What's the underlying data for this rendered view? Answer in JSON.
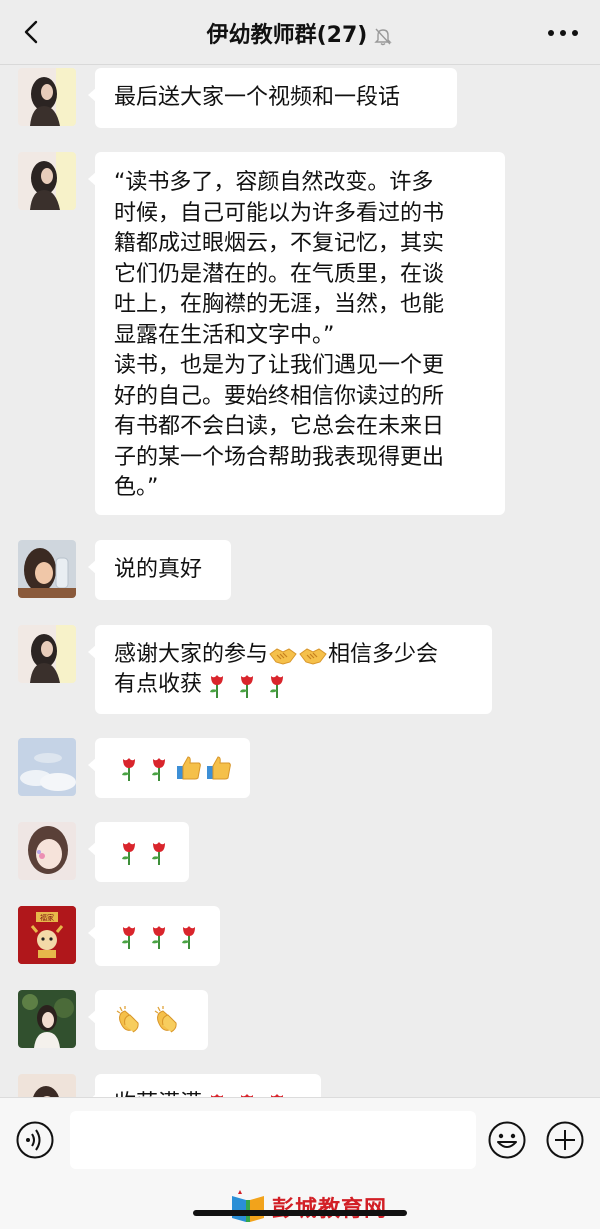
{
  "header": {
    "title": "伊幼教师群(27)",
    "back_icon": "chevron-left-icon",
    "mute_icon": "bell-muted-icon",
    "more_icon": "more-dots-icon"
  },
  "messages": [
    {
      "avatar": "avatar-girl-long-hair",
      "text": "最后送大家一个视频和一段话"
    },
    {
      "avatar": "avatar-girl-long-hair",
      "text": "“读书多了，容颜自然改变。许多\n时候，自己可能以为许多看过的书\n籍都成过眼烟云，不复记忆，其实\n它们仍是潜在的。在气质里，在谈\n吐上，在胸襟的无涯，当然，也能\n显露在生活和文字中。”\n读书，也是为了让我们遇见一个更\n好的自己。要始终相信你读过的所\n有书都不会白读，它总会在未来日\n子的某一个场合帮助我表现得更出\n色。”"
    },
    {
      "avatar": "avatar-child-drinking",
      "text": "说的真好"
    },
    {
      "avatar": "avatar-girl-long-hair",
      "text_line1": "感谢大家的参与",
      "text_line1_after": "相信多少会",
      "text_line2": "有点收获",
      "emoji_line1": [
        "handshake",
        "handshake"
      ],
      "emoji_line2": [
        "rose",
        "rose",
        "rose"
      ]
    },
    {
      "avatar": "avatar-sky-clouds",
      "emojis": [
        "rose",
        "rose",
        "thumbs-up",
        "thumbs-up"
      ]
    },
    {
      "avatar": "avatar-girl-face-paint",
      "emojis": [
        "rose",
        "rose"
      ]
    },
    {
      "avatar": "avatar-red-card-mascot",
      "avatar_caption": "福家",
      "emojis": [
        "rose",
        "rose",
        "rose"
      ]
    },
    {
      "avatar": "avatar-girl-flowers",
      "emojis": [
        "clapping-hands",
        "clapping-hands"
      ]
    },
    {
      "avatar": "avatar-girl-partial",
      "text": "收获满满",
      "emojis": [
        "rose",
        "rose",
        "rose"
      ]
    }
  ],
  "input_bar": {
    "voice_icon": "voice-icon",
    "emoji_icon": "emoji-smile-icon",
    "plus_icon": "plus-icon",
    "input_value": ""
  },
  "watermark": {
    "text": "彭城教育网"
  },
  "colors": {
    "background": "#ededed",
    "bubble": "#ffffff",
    "rose": "#d9252c",
    "watermark": "#d21f26"
  }
}
